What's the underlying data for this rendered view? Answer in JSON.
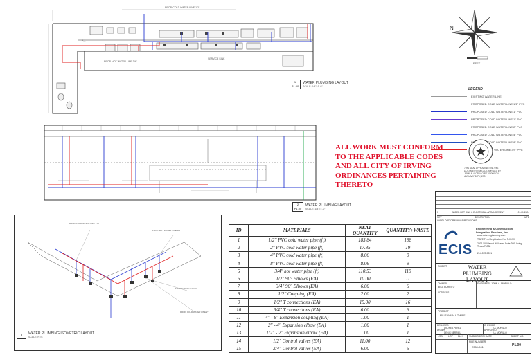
{
  "notice": [
    "ALL WORK MUST CONFORM",
    "TO THE APPLICABLE CODES",
    "AND ALL CITY OF IRVING",
    "ORDINANCES PERTAINING",
    "THERETO"
  ],
  "plan_caption": {
    "title": "WATER PLUMBING LAYOUT",
    "scale": "SCALE: 1/4\"=1'-0\"",
    "number": "1",
    "sheet": "P1.00"
  },
  "elevation_caption": {
    "title": "WATER PLUMBING LAYOUT",
    "scale": "SCALE: 1/4\"=1'-0\"",
    "number": "2",
    "sheet": "P1.00"
  },
  "iso_caption": {
    "title": "WATER PLUMBING ISOMETRIC LAYOUT",
    "scale": "SCALE: NTS",
    "number": "3"
  },
  "legend": {
    "title": "LEGEND",
    "items": [
      {
        "label": "EXISTING WATER LINE",
        "color": "#9a9a9a"
      },
      {
        "label": "PROPOSED COLD WATER LINE 1/2\" PVC",
        "color": "#18c4d8"
      },
      {
        "label": "PROPOSED COLD WATER LINE 1\" PVC",
        "color": "#2233cc"
      },
      {
        "label": "PROPOSED COLD WATER LINE 1\" PVC",
        "color": "#6a3bd1"
      },
      {
        "label": "PROPOSED COLD WATER LINE 2\" PVC",
        "color": "#1a1a9a"
      },
      {
        "label": "PROPOSED COLD WATER LINE 4\" PVC",
        "color": "#3355ee"
      },
      {
        "label": "PROPOSED COLD WATER LINE 8\" PVC",
        "color": "#1f4fbf"
      },
      {
        "label": "PROPOSED HOT WATER LINE 3/4\" PVC",
        "color": "#e02020"
      }
    ]
  },
  "materials_table": {
    "headers": [
      "ID",
      "MATERIALS",
      "NEAT QUANTITY",
      "QUANTITY+WASTE"
    ],
    "rows": [
      [
        "1",
        "1/2\" PVC cold water pipe (ft)",
        "183.84",
        "198"
      ],
      [
        "2",
        "2\" PVC cold water pipe (ft)",
        "17.85",
        "19"
      ],
      [
        "3",
        "4\" PVC cold water pipe (ft)",
        "8.06",
        "9"
      ],
      [
        "4",
        "8\" PVC cold water pipe (ft)",
        "8.06",
        "9"
      ],
      [
        "5",
        "3/4\" hot water pipe (ft)",
        "110.53",
        "119"
      ],
      [
        "6",
        "1/2\" 90° Elbows (EA)",
        "10.00",
        "11"
      ],
      [
        "7",
        "3/4\" 90° Elbows (EA)",
        "6.00",
        "6"
      ],
      [
        "8",
        "1/2\" Coupling (EA)",
        "2.00",
        "2"
      ],
      [
        "9",
        "1/2\" T connections (EA)",
        "15.00",
        "16"
      ],
      [
        "10",
        "3/4\" T connections (EA)",
        "6.00",
        "6"
      ],
      [
        "11",
        "4\" - 8\" Expansion coupling (EA)",
        "1.00",
        "1"
      ],
      [
        "12",
        "2\" - 4\" Expansion elbow (EA)",
        "1.00",
        "1"
      ],
      [
        "13",
        "1/2\" - 2\" Expansion elbow (EA)",
        "1.00",
        "1"
      ],
      [
        "14",
        "1/2\" Control valves (EA)",
        "11.00",
        "12"
      ],
      [
        "15",
        "3/4\" Control valves (EA)",
        "6.00",
        "6"
      ]
    ]
  },
  "title_block": {
    "rev_no": "1",
    "rev_desc": "ADDED HOT SINK & ELECTRICAL ARRANGEMENT",
    "rev_date": "01-01-2024",
    "rev_header": [
      "REV",
      "DESCRIPTION",
      "DATE"
    ],
    "rev_caption": "LANDLORD DRAWINGS/REVISIONS",
    "company_name": "Engineering & Construction Integration Services, Inc.",
    "company_url": "www.ecis-engineering.com",
    "company_reg": "TBPE Firm Registration No. F-XXXX",
    "company_addr": "2001 W. Walnut Hill Lane, Suite 200, Irving, Texas 75038",
    "company_phone": "214-578-5201",
    "logo_text": "ECIS",
    "sheet_label": "SHEET",
    "sheet_title": "WATER PLUMBING LAYOUT",
    "owner_label": "OWNER",
    "owner_value": "BELL BURRITO",
    "engineer_label": "ENGINEER",
    "engineer_value": "JOHN A. MORILLO",
    "address_label": "ADDRESS",
    "project_label": "PROJECT",
    "project_value": "MILLENNIUM & THREE",
    "designed_label": "DESIGNED",
    "designed_value": "ANDREA PEREZ",
    "checked_label": "CHECKED",
    "checked_value": "J.A. MORILLO",
    "drawn_label": "DRAWN",
    "drawn_value": "DENIS BERRIEL",
    "approved_label": "APPROVED",
    "approved_value": "J.A. MORILLO",
    "grid": [
      "LSB",
      "LOT",
      "BLK",
      "SUBMISSION DATE",
      "SHEET NO."
    ],
    "file_label": "FILE NUMBER",
    "file_value": "2350-901",
    "sheet_no": "P1.00"
  },
  "compass_label": "N",
  "scale_label": "FEET",
  "seal_note": "THIS SEAL APPEARING ON THIS DOCUMENT WAS AUTHORIZED BY JOHN A. MORILLO P.E. 00000 ON JANUARY 11TH, 2024"
}
